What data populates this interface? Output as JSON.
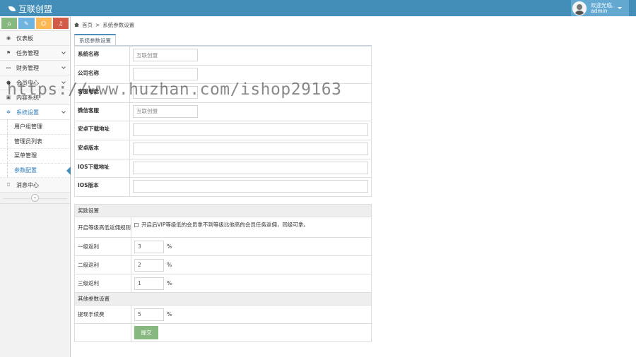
{
  "header": {
    "brand": "互联创盟",
    "greeting": "欢迎光临,",
    "username": "admin"
  },
  "shortcuts": [
    {
      "icon": "home-icon",
      "color": "#87b87f",
      "glyph": "⌂"
    },
    {
      "icon": "pencil-icon",
      "color": "#6fb3e0",
      "glyph": "✎"
    },
    {
      "icon": "users-icon",
      "color": "#ffb752",
      "glyph": "☺"
    },
    {
      "icon": "bell-icon",
      "color": "#d15b47",
      "glyph": "♫"
    }
  ],
  "sidebar": {
    "items": [
      {
        "label": "仪表板",
        "icon": "dashboard-icon",
        "glyph": "◉"
      },
      {
        "label": "任务管理",
        "icon": "flag-icon",
        "glyph": "⚑"
      },
      {
        "label": "财务管理",
        "icon": "credit-card-icon",
        "glyph": "▭"
      },
      {
        "label": "会员中心",
        "icon": "user-icon",
        "glyph": "●"
      },
      {
        "label": "内容系统",
        "icon": "picture-icon",
        "glyph": "▣"
      },
      {
        "label": "系统设置",
        "icon": "cog-icon",
        "glyph": "✲"
      }
    ],
    "sub_items": [
      "用户组管理",
      "管理员列表",
      "菜单管理",
      "参数配置"
    ],
    "last_item": {
      "label": "消息中心",
      "icon": "bookmark-icon",
      "glyph": "⎕"
    }
  },
  "breadcrumb": {
    "home": "首页",
    "sep": ">",
    "current": "系统参数设置"
  },
  "tab": "系统参数设置",
  "form1": [
    {
      "label": "系统名称",
      "placeholder": "互联创盟",
      "size": "short"
    },
    {
      "label": "公司名称",
      "placeholder": "",
      "size": "short"
    },
    {
      "label": "客服电话",
      "placeholder": "",
      "size": "short"
    },
    {
      "label": "微信客服",
      "placeholder": "互联创盟",
      "size": "short"
    },
    {
      "label": "安卓下载地址",
      "placeholder": "",
      "size": "long"
    },
    {
      "label": "安卓版本",
      "placeholder": "",
      "size": "long"
    },
    {
      "label": "IOS下载地址",
      "placeholder": "",
      "size": "long"
    },
    {
      "label": "IOS版本",
      "placeholder": "",
      "size": "long"
    }
  ],
  "reward": {
    "title": "奖励设置",
    "rule_label": "开启等级高低返佣规则",
    "rule_text": "开启后VIP等级低的会员拿不到等级比他高的会员任务返佣，同级可拿。",
    "levels": [
      {
        "label": "一级返利",
        "value": "3",
        "unit": "%"
      },
      {
        "label": "二级返利",
        "value": "2",
        "unit": "%"
      },
      {
        "label": "三级返利",
        "value": "1",
        "unit": "%"
      }
    ]
  },
  "other": {
    "title": "其他参数设置",
    "fee_label": "提现手续费",
    "fee_value": "5",
    "fee_unit": "%",
    "submit": "提交"
  },
  "watermark": "https://www.huzhan.com/ishop29163"
}
